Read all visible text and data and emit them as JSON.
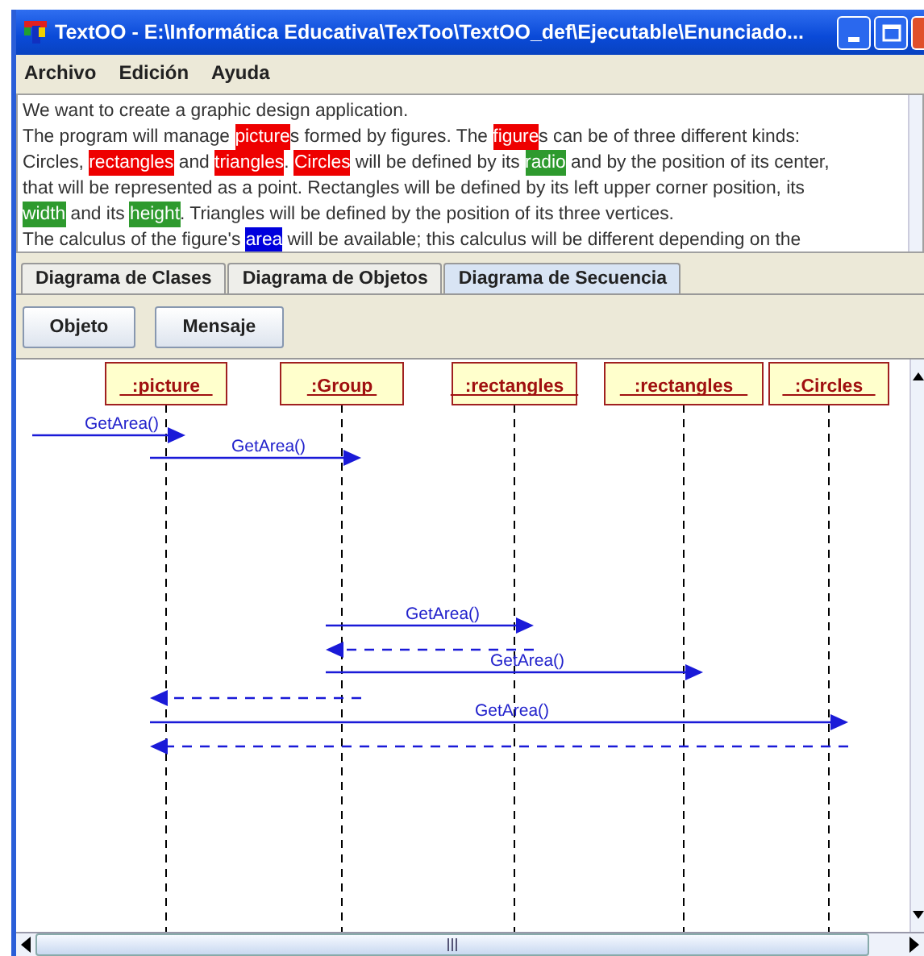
{
  "window": {
    "title": "TextOO - E:\\Informática Educativa\\TexToo\\TextOO_def\\Ejecutable\\Enunciado..."
  },
  "menu": [
    {
      "label": "Archivo"
    },
    {
      "label": "Edición"
    },
    {
      "label": "Ayuda"
    }
  ],
  "statement": {
    "lines": [
      [
        {
          "text": "We want to create a graphic design application."
        }
      ],
      [
        {
          "text": "The program will manage "
        },
        {
          "text": "picture",
          "color": "#ee0000",
          "after": "s formed by figures. The "
        },
        {
          "text": "figure",
          "color": "#ee0000",
          "after": "s can be of three different kinds:"
        }
      ],
      [
        {
          "text": "Circles, "
        },
        {
          "text": "rectangles",
          "color": "#ee0000",
          "after": " and "
        },
        {
          "text": "triangles",
          "color": "#ee0000",
          "after": ". "
        },
        {
          "text": "Circles",
          "color": "#ee0000",
          "after": " will be defined by its "
        },
        {
          "text": "radio",
          "color": "#2e9a2e",
          "after": " and by the position of its center,"
        }
      ],
      [
        {
          "text": "that will be represented as a point. Rectangles will be defined by its left upper corner position, its"
        }
      ],
      [
        {
          "text": "width",
          "color": "#2e9a2e",
          "after": " and its "
        },
        {
          "text": "height",
          "color": "#2e9a2e",
          "after": ". Triangles will be defined by the position of its three vertices."
        }
      ],
      [
        {
          "text": "The calculus of the figure's "
        },
        {
          "text": "area",
          "color": "#0000dd",
          "after": " will be available; this calculus will be different depending on the"
        }
      ]
    ]
  },
  "tabs": [
    {
      "label": "Diagrama de Clases",
      "selected": false
    },
    {
      "label": "Diagrama de Objetos",
      "selected": false
    },
    {
      "label": "Diagrama de Secuencia",
      "selected": true
    }
  ],
  "toolbar": [
    {
      "label": "Objeto"
    },
    {
      "label": "Mensaje"
    }
  ],
  "diagram": {
    "objects": [
      {
        "label": ":picture"
      },
      {
        "label": ":Group"
      },
      {
        "label": ":rectangles"
      },
      {
        "label": ":rectangles"
      },
      {
        "label": ":Circles"
      }
    ],
    "messages": [
      {
        "kind": "call",
        "label": "GetArea()"
      },
      {
        "kind": "call",
        "label": "GetArea()"
      },
      {
        "kind": "call",
        "label": "GetArea()"
      },
      {
        "kind": "return"
      },
      {
        "kind": "call",
        "label": "GetArea()"
      },
      {
        "kind": "return"
      },
      {
        "kind": "call",
        "label": "GetArea()"
      },
      {
        "kind": "return"
      }
    ]
  }
}
